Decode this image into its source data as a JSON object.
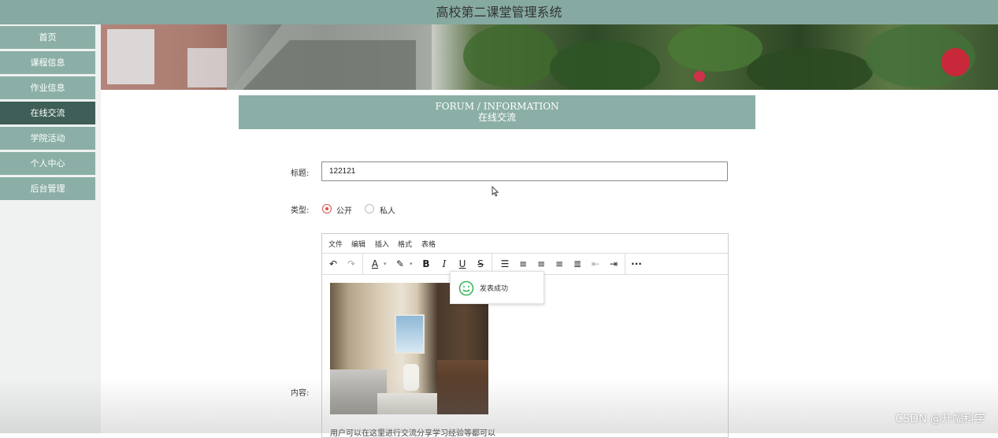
{
  "app_title": "高校第二课堂管理系统",
  "sidebar": {
    "items": [
      {
        "label": "首页",
        "active": false
      },
      {
        "label": "课程信息",
        "active": false
      },
      {
        "label": "作业信息",
        "active": false
      },
      {
        "label": "在线交流",
        "active": true
      },
      {
        "label": "学院活动",
        "active": false
      },
      {
        "label": "个人中心",
        "active": false
      },
      {
        "label": "后台管理",
        "active": false
      }
    ]
  },
  "section": {
    "title_en": "FORUM / INFORMATION",
    "title_zh": "在线交流"
  },
  "form": {
    "title_label": "标题:",
    "title_value": "122121",
    "type_label": "类型:",
    "type_options": [
      "公开",
      "私人"
    ],
    "type_selected": "公开",
    "content_label": "内容:"
  },
  "editor": {
    "menu": [
      "文件",
      "编辑",
      "插入",
      "格式",
      "表格"
    ],
    "toolbar_icons": [
      "undo-icon",
      "redo-icon",
      "font-color-icon",
      "highlight-color-icon",
      "bold-icon",
      "italic-icon",
      "underline-icon",
      "strikethrough-icon",
      "bullet-list-icon",
      "align-left-icon",
      "align-center-icon",
      "align-right-icon",
      "align-justify-icon",
      "outdent-icon",
      "indent-icon",
      "more-icon"
    ],
    "content_text": "用户可以在这里进行交流分享学习经验等都可以"
  },
  "toast": {
    "message": "发表成功",
    "icon": "smile-icon"
  },
  "watermark": "CSDN @升幅科学",
  "colors": {
    "accent": "#86aaa1",
    "nav_active": "#3e5e57",
    "radio_checked": "#d9534f",
    "toast_icon": "#3bb85c"
  }
}
